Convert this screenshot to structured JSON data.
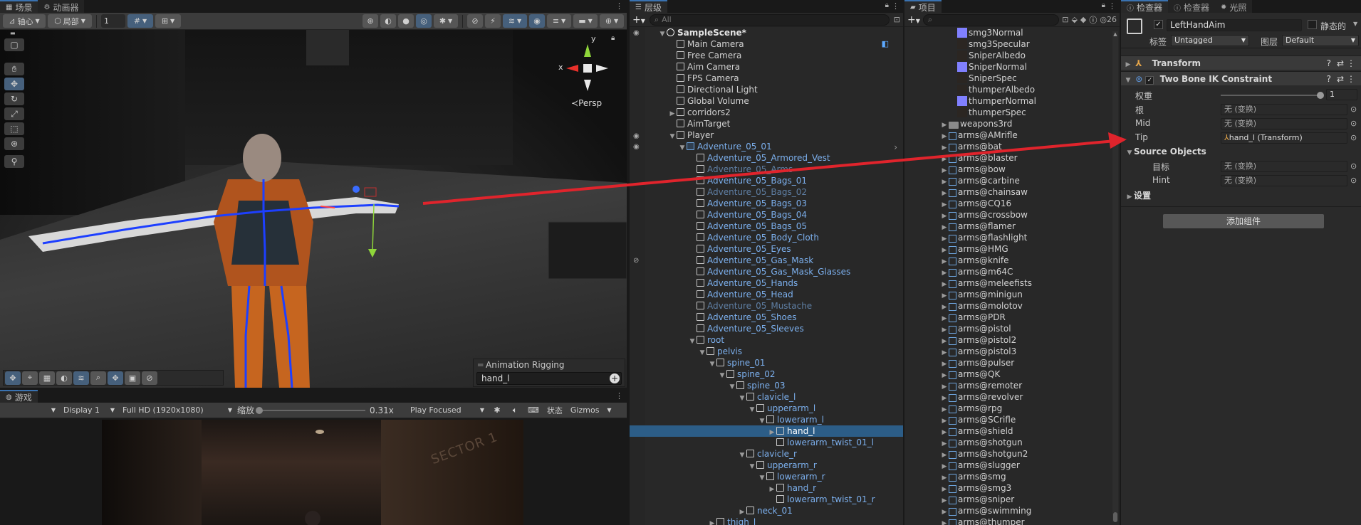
{
  "scene_panel": {
    "tabs": [
      "场景",
      "动画器"
    ],
    "toolbar": {
      "pivot_label": "轴心",
      "local_label": "局部",
      "grid_count": "1"
    },
    "gizmo_persp": "Persp",
    "gizmo_x": "x",
    "gizmo_y": "y",
    "overlay": {
      "title": "Animation Rigging",
      "search_value": "hand_l"
    }
  },
  "game_panel": {
    "tab": "游戏",
    "display": "Display 1",
    "resolution": "Full HD (1920x1080)",
    "scale_label": "缩放",
    "scale_value": "0.31x",
    "play_mode": "Play Focused",
    "stats_label": "状态",
    "gizmos_label": "Gizmos",
    "sign_text": "SECTOR 1"
  },
  "hierarchy": {
    "tab": "层级",
    "search_placeholder": "All",
    "rows": [
      {
        "label": "SampleScene*",
        "depth": 0,
        "arrow": "down",
        "icon": "unity-scene-icon",
        "style": "bold"
      },
      {
        "label": "Main Camera",
        "depth": 1,
        "arrow": "",
        "icon": "cube-icon",
        "style": "normal"
      },
      {
        "label": "Free Camera",
        "depth": 1,
        "arrow": "",
        "icon": "cube-icon",
        "style": "normal"
      },
      {
        "label": "Aim Camera",
        "depth": 1,
        "arrow": "",
        "icon": "cube-icon",
        "style": "normal"
      },
      {
        "label": "FPS Camera",
        "depth": 1,
        "arrow": "",
        "icon": "cube-icon",
        "style": "normal"
      },
      {
        "label": "Directional Light",
        "depth": 1,
        "arrow": "",
        "icon": "cube-icon",
        "style": "normal"
      },
      {
        "label": "Global Volume",
        "depth": 1,
        "arrow": "",
        "icon": "cube-icon",
        "style": "normal"
      },
      {
        "label": "corridors2",
        "depth": 1,
        "arrow": "right",
        "icon": "cube-icon",
        "style": "normal"
      },
      {
        "label": "AimTarget",
        "depth": 1,
        "arrow": "",
        "icon": "cube-icon",
        "style": "normal"
      },
      {
        "label": "Player",
        "depth": 1,
        "arrow": "down",
        "icon": "cube-icon",
        "style": "normal"
      },
      {
        "label": "Adventure_05_01",
        "depth": 2,
        "arrow": "down",
        "icon": "prefab-icon",
        "style": "blue"
      },
      {
        "label": "Adventure_05_Armored_Vest",
        "depth": 3,
        "arrow": "",
        "icon": "cube-icon",
        "style": "blue"
      },
      {
        "label": "Adventure_05_Arms",
        "depth": 3,
        "arrow": "",
        "icon": "cube-icon",
        "style": "faded"
      },
      {
        "label": "Adventure_05_Bags_01",
        "depth": 3,
        "arrow": "",
        "icon": "cube-icon",
        "style": "blue"
      },
      {
        "label": "Adventure_05_Bags_02",
        "depth": 3,
        "arrow": "",
        "icon": "cube-icon",
        "style": "faded"
      },
      {
        "label": "Adventure_05_Bags_03",
        "depth": 3,
        "arrow": "",
        "icon": "cube-icon",
        "style": "blue"
      },
      {
        "label": "Adventure_05_Bags_04",
        "depth": 3,
        "arrow": "",
        "icon": "cube-icon",
        "style": "blue"
      },
      {
        "label": "Adventure_05_Bags_05",
        "depth": 3,
        "arrow": "",
        "icon": "cube-icon",
        "style": "blue"
      },
      {
        "label": "Adventure_05_Body_Cloth",
        "depth": 3,
        "arrow": "",
        "icon": "cube-icon",
        "style": "blue"
      },
      {
        "label": "Adventure_05_Eyes",
        "depth": 3,
        "arrow": "",
        "icon": "cube-icon",
        "style": "blue"
      },
      {
        "label": "Adventure_05_Gas_Mask",
        "depth": 3,
        "arrow": "",
        "icon": "cube-icon",
        "style": "blue"
      },
      {
        "label": "Adventure_05_Gas_Mask_Glasses",
        "depth": 3,
        "arrow": "",
        "icon": "cube-icon",
        "style": "blue"
      },
      {
        "label": "Adventure_05_Hands",
        "depth": 3,
        "arrow": "",
        "icon": "cube-icon",
        "style": "blue"
      },
      {
        "label": "Adventure_05_Head",
        "depth": 3,
        "arrow": "",
        "icon": "cube-icon",
        "style": "blue"
      },
      {
        "label": "Adventure_05_Mustache",
        "depth": 3,
        "arrow": "",
        "icon": "cube-icon",
        "style": "faded"
      },
      {
        "label": "Adventure_05_Shoes",
        "depth": 3,
        "arrow": "",
        "icon": "cube-icon",
        "style": "blue"
      },
      {
        "label": "Adventure_05_Sleeves",
        "depth": 3,
        "arrow": "",
        "icon": "cube-icon",
        "style": "blue"
      },
      {
        "label": "root",
        "depth": 3,
        "arrow": "down",
        "icon": "cube-icon",
        "style": "blue"
      },
      {
        "label": "pelvis",
        "depth": 4,
        "arrow": "down",
        "icon": "cube-icon",
        "style": "blue"
      },
      {
        "label": "spine_01",
        "depth": 5,
        "arrow": "down",
        "icon": "cube-icon",
        "style": "blue"
      },
      {
        "label": "spine_02",
        "depth": 6,
        "arrow": "down",
        "icon": "cube-icon",
        "style": "blue"
      },
      {
        "label": "spine_03",
        "depth": 7,
        "arrow": "down",
        "icon": "cube-icon",
        "style": "blue"
      },
      {
        "label": "clavicle_l",
        "depth": 8,
        "arrow": "down",
        "icon": "cube-icon",
        "style": "blue"
      },
      {
        "label": "upperarm_l",
        "depth": 9,
        "arrow": "down",
        "icon": "cube-icon",
        "style": "blue"
      },
      {
        "label": "lowerarm_l",
        "depth": 10,
        "arrow": "down",
        "icon": "cube-icon",
        "style": "blue"
      },
      {
        "label": "hand_l",
        "depth": 11,
        "arrow": "right",
        "icon": "cube-icon",
        "style": "selected"
      },
      {
        "label": "lowerarm_twist_01_l",
        "depth": 11,
        "arrow": "",
        "icon": "cube-icon",
        "style": "blue"
      },
      {
        "label": "clavicle_r",
        "depth": 8,
        "arrow": "down",
        "icon": "cube-icon",
        "style": "blue"
      },
      {
        "label": "upperarm_r",
        "depth": 9,
        "arrow": "down",
        "icon": "cube-icon",
        "style": "blue"
      },
      {
        "label": "lowerarm_r",
        "depth": 10,
        "arrow": "down",
        "icon": "cube-icon",
        "style": "blue"
      },
      {
        "label": "hand_r",
        "depth": 11,
        "arrow": "right",
        "icon": "cube-icon",
        "style": "blue"
      },
      {
        "label": "lowerarm_twist_01_r",
        "depth": 11,
        "arrow": "",
        "icon": "cube-icon",
        "style": "blue"
      },
      {
        "label": "neck_01",
        "depth": 8,
        "arrow": "right",
        "icon": "cube-icon",
        "style": "blue"
      },
      {
        "label": "thigh_l",
        "depth": 5,
        "arrow": "right",
        "icon": "cube-icon",
        "style": "blue"
      }
    ]
  },
  "project": {
    "tab": "项目",
    "count": "26",
    "rows": [
      {
        "label": "smg3Normal",
        "type": "normal-map",
        "depth": 1
      },
      {
        "label": "smg3Specular",
        "type": "dark-tex",
        "depth": 1
      },
      {
        "label": "SniperAlbedo",
        "type": "dark-tex",
        "depth": 1
      },
      {
        "label": "SniperNormal",
        "type": "normal-map",
        "depth": 1
      },
      {
        "label": "SniperSpec",
        "type": "dark-tex",
        "depth": 1
      },
      {
        "label": "thumperAlbedo",
        "type": "dark-tex",
        "depth": 1
      },
      {
        "label": "thumperNormal",
        "type": "normal-map",
        "depth": 1
      },
      {
        "label": "thumperSpec",
        "type": "dark-tex",
        "depth": 1
      },
      {
        "label": "weapons3rd",
        "type": "folder",
        "depth": 0
      },
      {
        "label": "arms@AMrifle",
        "type": "model",
        "depth": 0
      },
      {
        "label": "arms@bat",
        "type": "model",
        "depth": 0
      },
      {
        "label": "arms@blaster",
        "type": "model",
        "depth": 0
      },
      {
        "label": "arms@bow",
        "type": "model",
        "depth": 0
      },
      {
        "label": "arms@carbine",
        "type": "model",
        "depth": 0
      },
      {
        "label": "arms@chainsaw",
        "type": "model",
        "depth": 0
      },
      {
        "label": "arms@CQ16",
        "type": "model",
        "depth": 0
      },
      {
        "label": "arms@crossbow",
        "type": "model",
        "depth": 0
      },
      {
        "label": "arms@flamer",
        "type": "model",
        "depth": 0
      },
      {
        "label": "arms@flashlight",
        "type": "model",
        "depth": 0
      },
      {
        "label": "arms@HMG",
        "type": "model",
        "depth": 0
      },
      {
        "label": "arms@knife",
        "type": "model",
        "depth": 0
      },
      {
        "label": "arms@m64C",
        "type": "model",
        "depth": 0
      },
      {
        "label": "arms@meleefists",
        "type": "model",
        "depth": 0
      },
      {
        "label": "arms@minigun",
        "type": "model",
        "depth": 0
      },
      {
        "label": "arms@molotov",
        "type": "model",
        "depth": 0
      },
      {
        "label": "arms@PDR",
        "type": "model",
        "depth": 0
      },
      {
        "label": "arms@pistol",
        "type": "model",
        "depth": 0
      },
      {
        "label": "arms@pistol2",
        "type": "model",
        "depth": 0
      },
      {
        "label": "arms@pistol3",
        "type": "model",
        "depth": 0
      },
      {
        "label": "arms@pulser",
        "type": "model",
        "depth": 0
      },
      {
        "label": "arms@QK",
        "type": "model",
        "depth": 0
      },
      {
        "label": "arms@remoter",
        "type": "model",
        "depth": 0
      },
      {
        "label": "arms@revolver",
        "type": "model",
        "depth": 0
      },
      {
        "label": "arms@rpg",
        "type": "model",
        "depth": 0
      },
      {
        "label": "arms@SCrifle",
        "type": "model",
        "depth": 0
      },
      {
        "label": "arms@shield",
        "type": "model",
        "depth": 0
      },
      {
        "label": "arms@shotgun",
        "type": "model",
        "depth": 0
      },
      {
        "label": "arms@shotgun2",
        "type": "model",
        "depth": 0
      },
      {
        "label": "arms@slugger",
        "type": "model",
        "depth": 0
      },
      {
        "label": "arms@smg",
        "type": "model",
        "depth": 0
      },
      {
        "label": "arms@smg3",
        "type": "model",
        "depth": 0
      },
      {
        "label": "arms@sniper",
        "type": "model",
        "depth": 0
      },
      {
        "label": "arms@swimming",
        "type": "model",
        "depth": 0
      },
      {
        "label": "arms@thumper",
        "type": "model",
        "depth": 0
      }
    ]
  },
  "inspector": {
    "tabs": [
      "检查器",
      "检查器",
      "光照"
    ],
    "object_name": "LeftHandAim",
    "static_label": "静态的",
    "tag_label": "标签",
    "tag_value": "Untagged",
    "layer_label": "图层",
    "layer_value": "Default",
    "transform_label": "Transform",
    "constraint_label": "Two Bone IK Constraint",
    "weight_label": "权重",
    "weight_value": "1",
    "weight_fraction": 1,
    "root_label": "根",
    "root_value": "无 (变换)",
    "mid_label": "Mid",
    "mid_value": "无 (变换)",
    "tip_label": "Tip",
    "tip_value": "hand_l (Transform)",
    "source_label": "Source Objects",
    "target_label": "目标",
    "target_value": "无 (变换)",
    "hint_label": "Hint",
    "hint_value": "无 (变换)",
    "settings_label": "设置",
    "add_component_label": "添加组件"
  },
  "colors": {
    "accent_blue": "#2c5d87",
    "prefab_blue": "#7cb0ee",
    "arrow_red": "#e0242c"
  }
}
